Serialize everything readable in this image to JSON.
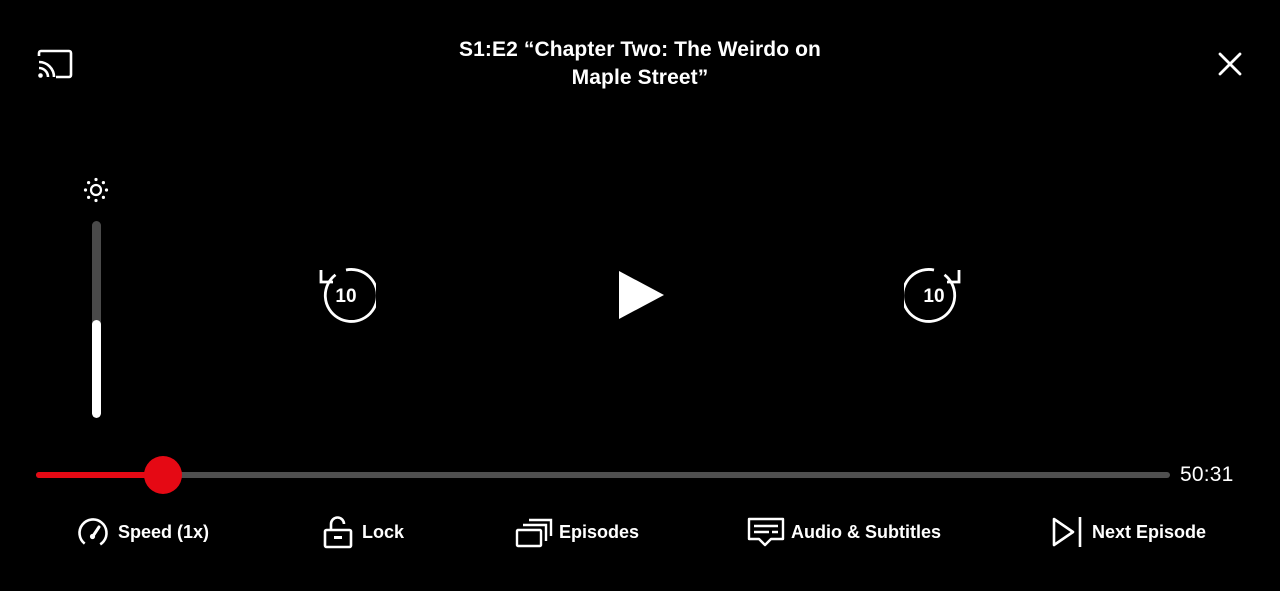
{
  "header": {
    "title_line1": "S1:E2 “Chapter Two: The Weirdo on",
    "title_line2": "Maple Street”",
    "cast_icon": "cast-icon",
    "close_icon": "close-icon"
  },
  "brightness": {
    "icon": "brightness-icon",
    "level": 0.5
  },
  "playback": {
    "skip_back_label": "10",
    "skip_forward_label": "10",
    "play_icon": "play-icon"
  },
  "progress": {
    "fraction": 0.112,
    "time_remaining": "50:31"
  },
  "controls": {
    "speed_label": "Speed (1x)",
    "lock_label": "Lock",
    "episodes_label": "Episodes",
    "audio_label": "Audio & Subtitles",
    "next_label": "Next Episode"
  },
  "colors": {
    "accent": "#e50914",
    "track": "#4f4f4f",
    "background": "#000000",
    "text": "#ffffff"
  }
}
